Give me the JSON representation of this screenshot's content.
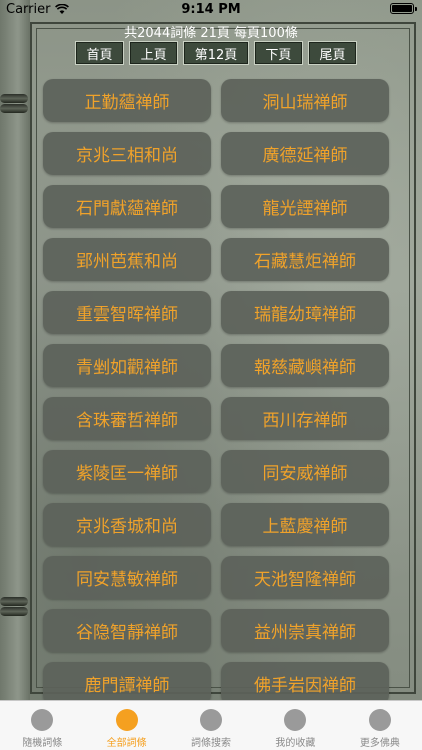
{
  "status": {
    "carrier": "Carrier",
    "time": "9:14 PM"
  },
  "summary": "共2044詞條 21頁 每頁100條",
  "pager": {
    "first": "首頁",
    "prev": "上頁",
    "current": "第12頁",
    "next": "下頁",
    "last": "尾頁"
  },
  "entries": [
    "正勤蘊禅師",
    "洞山瑞禅師",
    "京兆三相和尚",
    "廣德延禅師",
    "石門獻蘊禅師",
    "龍光諲禅師",
    "郢州芭蕉和尚",
    "石藏慧炬禅師",
    "重雲智晖禅師",
    "瑞龍幼璋禅師",
    "青剉如觀禅師",
    "報慈藏嶼禅師",
    "含珠審哲禅師",
    "西川存禅師",
    "紫陵匡一禅師",
    "同安威禅師",
    "京兆香城和尚",
    "上藍慶禅師",
    "同安慧敏禅師",
    "天池智隆禅師",
    "谷隐智靜禅師",
    "益州崇真禅師",
    "鹿門譚禅師",
    "佛手岩因禅師"
  ],
  "tabs": [
    {
      "label": "隨機詞條",
      "icon": "random-icon",
      "active": false
    },
    {
      "label": "全部詞條",
      "icon": "all-entries-icon",
      "active": true
    },
    {
      "label": "詞條搜索",
      "icon": "search-icon",
      "active": false
    },
    {
      "label": "我的收藏",
      "icon": "favorites-icon",
      "active": false
    },
    {
      "label": "更多佛典",
      "icon": "more-icon",
      "active": false
    }
  ],
  "colors": {
    "accent": "#f5a020",
    "entry_text": "#f0a22a",
    "button_bg": "#5c625a"
  }
}
